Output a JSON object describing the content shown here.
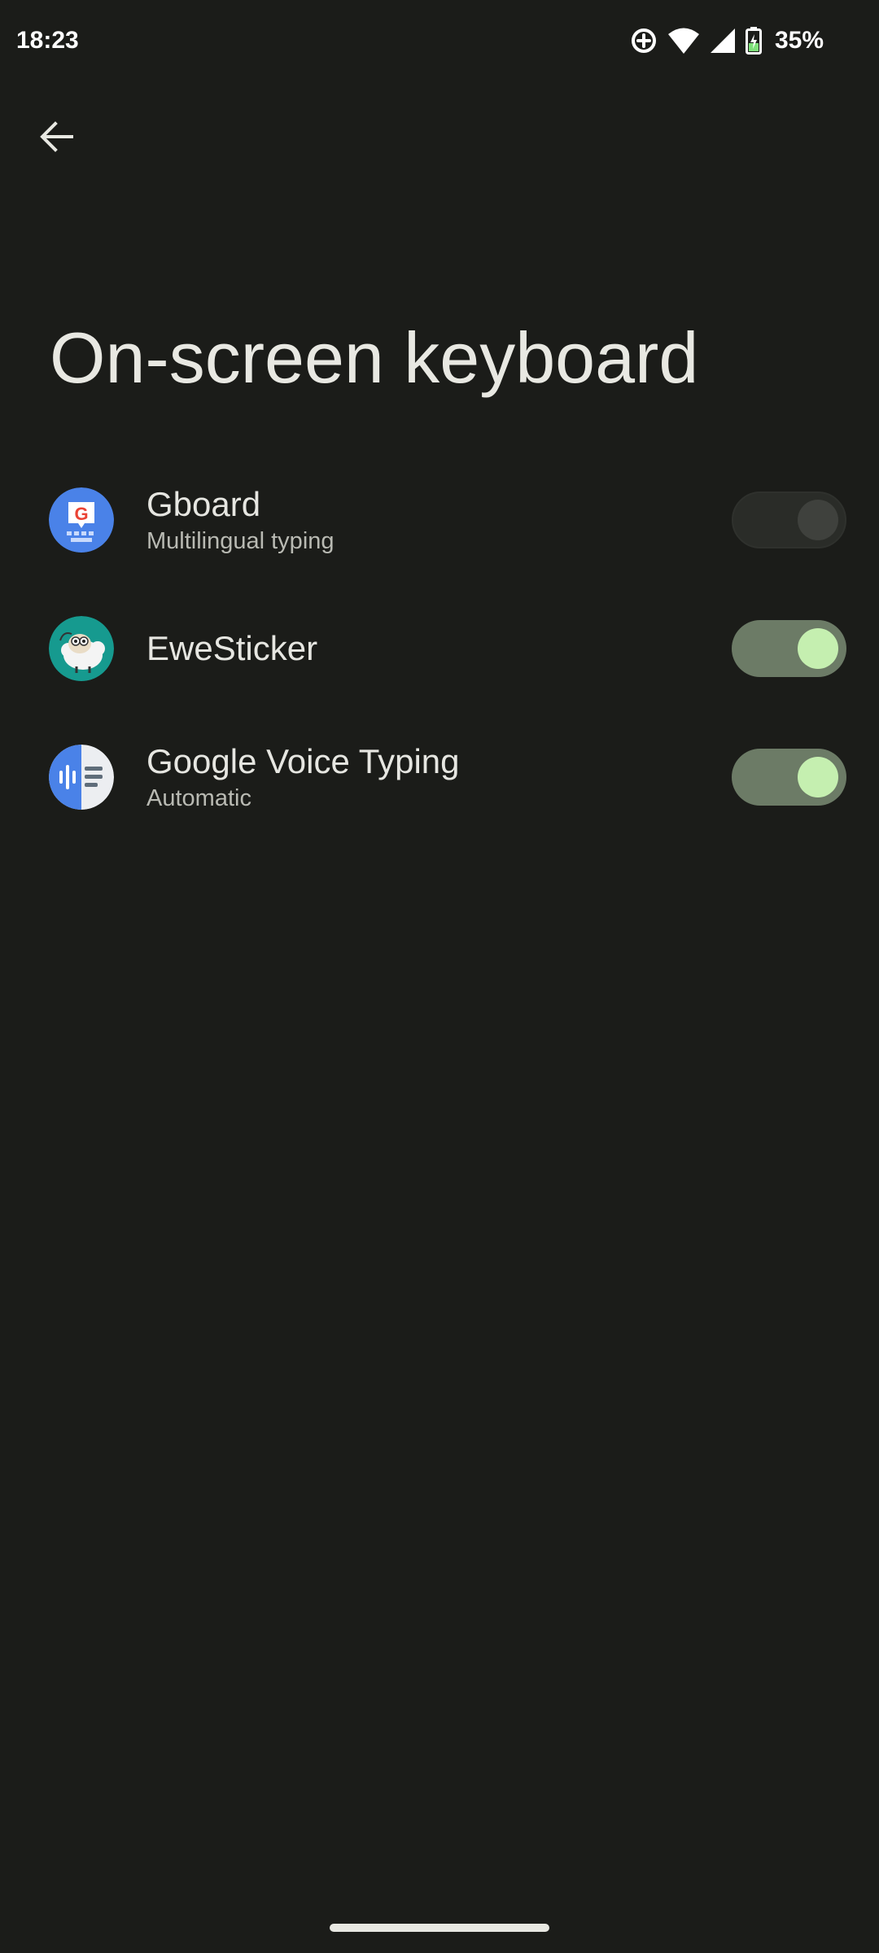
{
  "status_bar": {
    "time": "18:23",
    "battery_percent": "35%",
    "icons": [
      "data-saver-icon",
      "wifi-icon",
      "cell-signal-icon",
      "battery-charging-icon"
    ]
  },
  "header": {
    "back_icon": "arrow-back-icon",
    "title": "On-screen keyboard"
  },
  "keyboards": [
    {
      "title": "Gboard",
      "subtitle": "Multilingual typing",
      "icon": "gboard-icon",
      "enabled": false
    },
    {
      "title": "EweSticker",
      "subtitle": "",
      "icon": "ewesticker-icon",
      "enabled": true
    },
    {
      "title": "Google Voice Typing",
      "subtitle": "Automatic",
      "icon": "google-voice-typing-icon",
      "enabled": true
    }
  ],
  "colors": {
    "background": "#1b1c19",
    "toggle_on_track": "#6c7b66",
    "toggle_on_thumb": "#c5efb0",
    "toggle_off_track": "#2a2c28",
    "toggle_off_thumb": "#3f413d"
  }
}
